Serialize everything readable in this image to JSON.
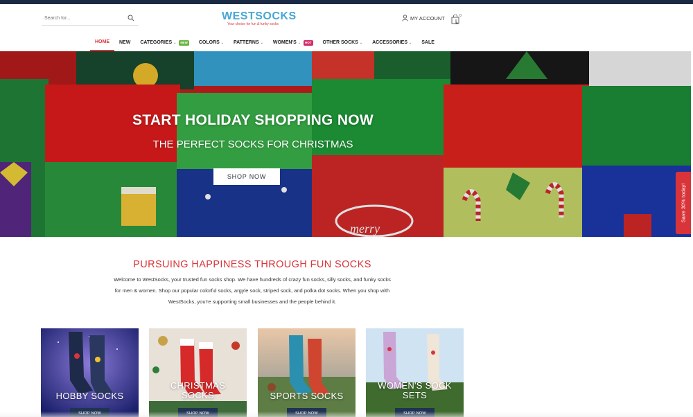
{
  "header": {
    "search_placeholder": "Search for...",
    "logo_name": "WESTSOCKS",
    "logo_tagline": "Your choice for fun & funky socks",
    "account_label": "MY ACCOUNT",
    "cart_count": "0"
  },
  "nav": {
    "items": [
      {
        "label": "HOME",
        "active": true
      },
      {
        "label": "NEW"
      },
      {
        "label": "CATEGORIES",
        "badge": "NEW"
      },
      {
        "label": "COLORS"
      },
      {
        "label": "PATTERNS"
      },
      {
        "label": "WOMEN'S",
        "badge": "HOT"
      },
      {
        "label": "OTHER SOCKS"
      },
      {
        "label": "ACCESSORIES"
      },
      {
        "label": "SALE"
      }
    ]
  },
  "hero": {
    "title": "START HOLIDAY SHOPPING NOW",
    "subtitle": "THE PERFECT SOCKS FOR CHRISTMAS",
    "button": "SHOP NOW",
    "sock_art_text": "merry"
  },
  "side_tab": "Save 30% today!",
  "intro": {
    "title": "PURSUING HAPPINESS THROUGH FUN SOCKS",
    "text": "Welcome to WestSocks, your trusted fun socks shop.  We have hundreds of crazy fun socks, silly socks, and funky socks for men & women. Shop our popular colorful socks, argyle sock, striped sock, and polka dot socks. When you shop with WestSocks, you're supporting small businesses and the people behind it."
  },
  "categories": [
    {
      "title": "HOBBY SOCKS",
      "button": "SHOP NOW"
    },
    {
      "title": "CHRISTMAS SOCKS",
      "button": "SHOP NOW"
    },
    {
      "title": "SPORTS SOCKS",
      "button": "SHOP NOW"
    },
    {
      "title": "WOMEN'S SOCK SETS",
      "button": "SHOP NOW"
    }
  ],
  "colors": {
    "accent_red": "#d9343a",
    "logo_blue": "#48a7d6",
    "dark_navy": "#1f3352"
  }
}
